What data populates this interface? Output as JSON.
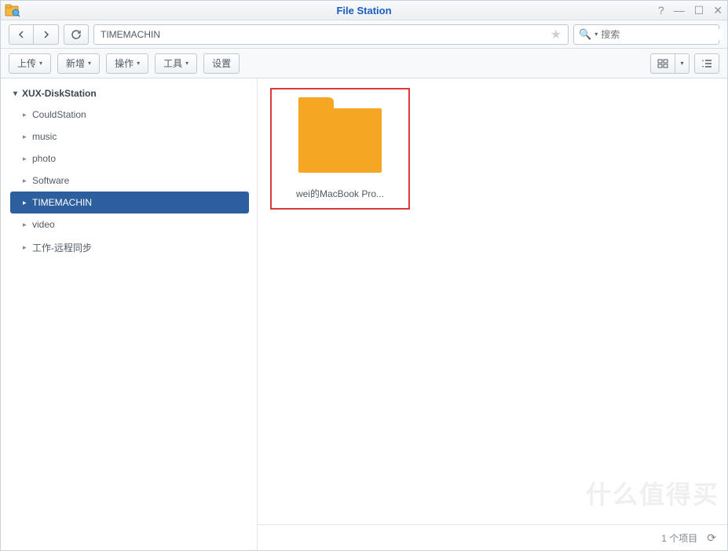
{
  "titlebar": {
    "app_name": "File Station"
  },
  "nav": {
    "path": "TIMEMACHIN",
    "search_placeholder": "搜索"
  },
  "toolbar": {
    "upload": "上传",
    "new": "新增",
    "action": "操作",
    "tools": "工具",
    "settings": "设置"
  },
  "sidebar": {
    "root": "XUX-DiskStation",
    "items": [
      {
        "label": "CouldStation",
        "selected": false
      },
      {
        "label": "music",
        "selected": false
      },
      {
        "label": "photo",
        "selected": false
      },
      {
        "label": "Software",
        "selected": false
      },
      {
        "label": "TIMEMACHIN",
        "selected": true
      },
      {
        "label": "video",
        "selected": false
      },
      {
        "label": "工作-远程同步",
        "selected": false
      }
    ]
  },
  "files": [
    {
      "name": "wei的MacBook Pro...",
      "type": "folder",
      "highlighted": true
    }
  ],
  "statusbar": {
    "item_count": "1 个项目"
  },
  "watermark": "什么值得买"
}
